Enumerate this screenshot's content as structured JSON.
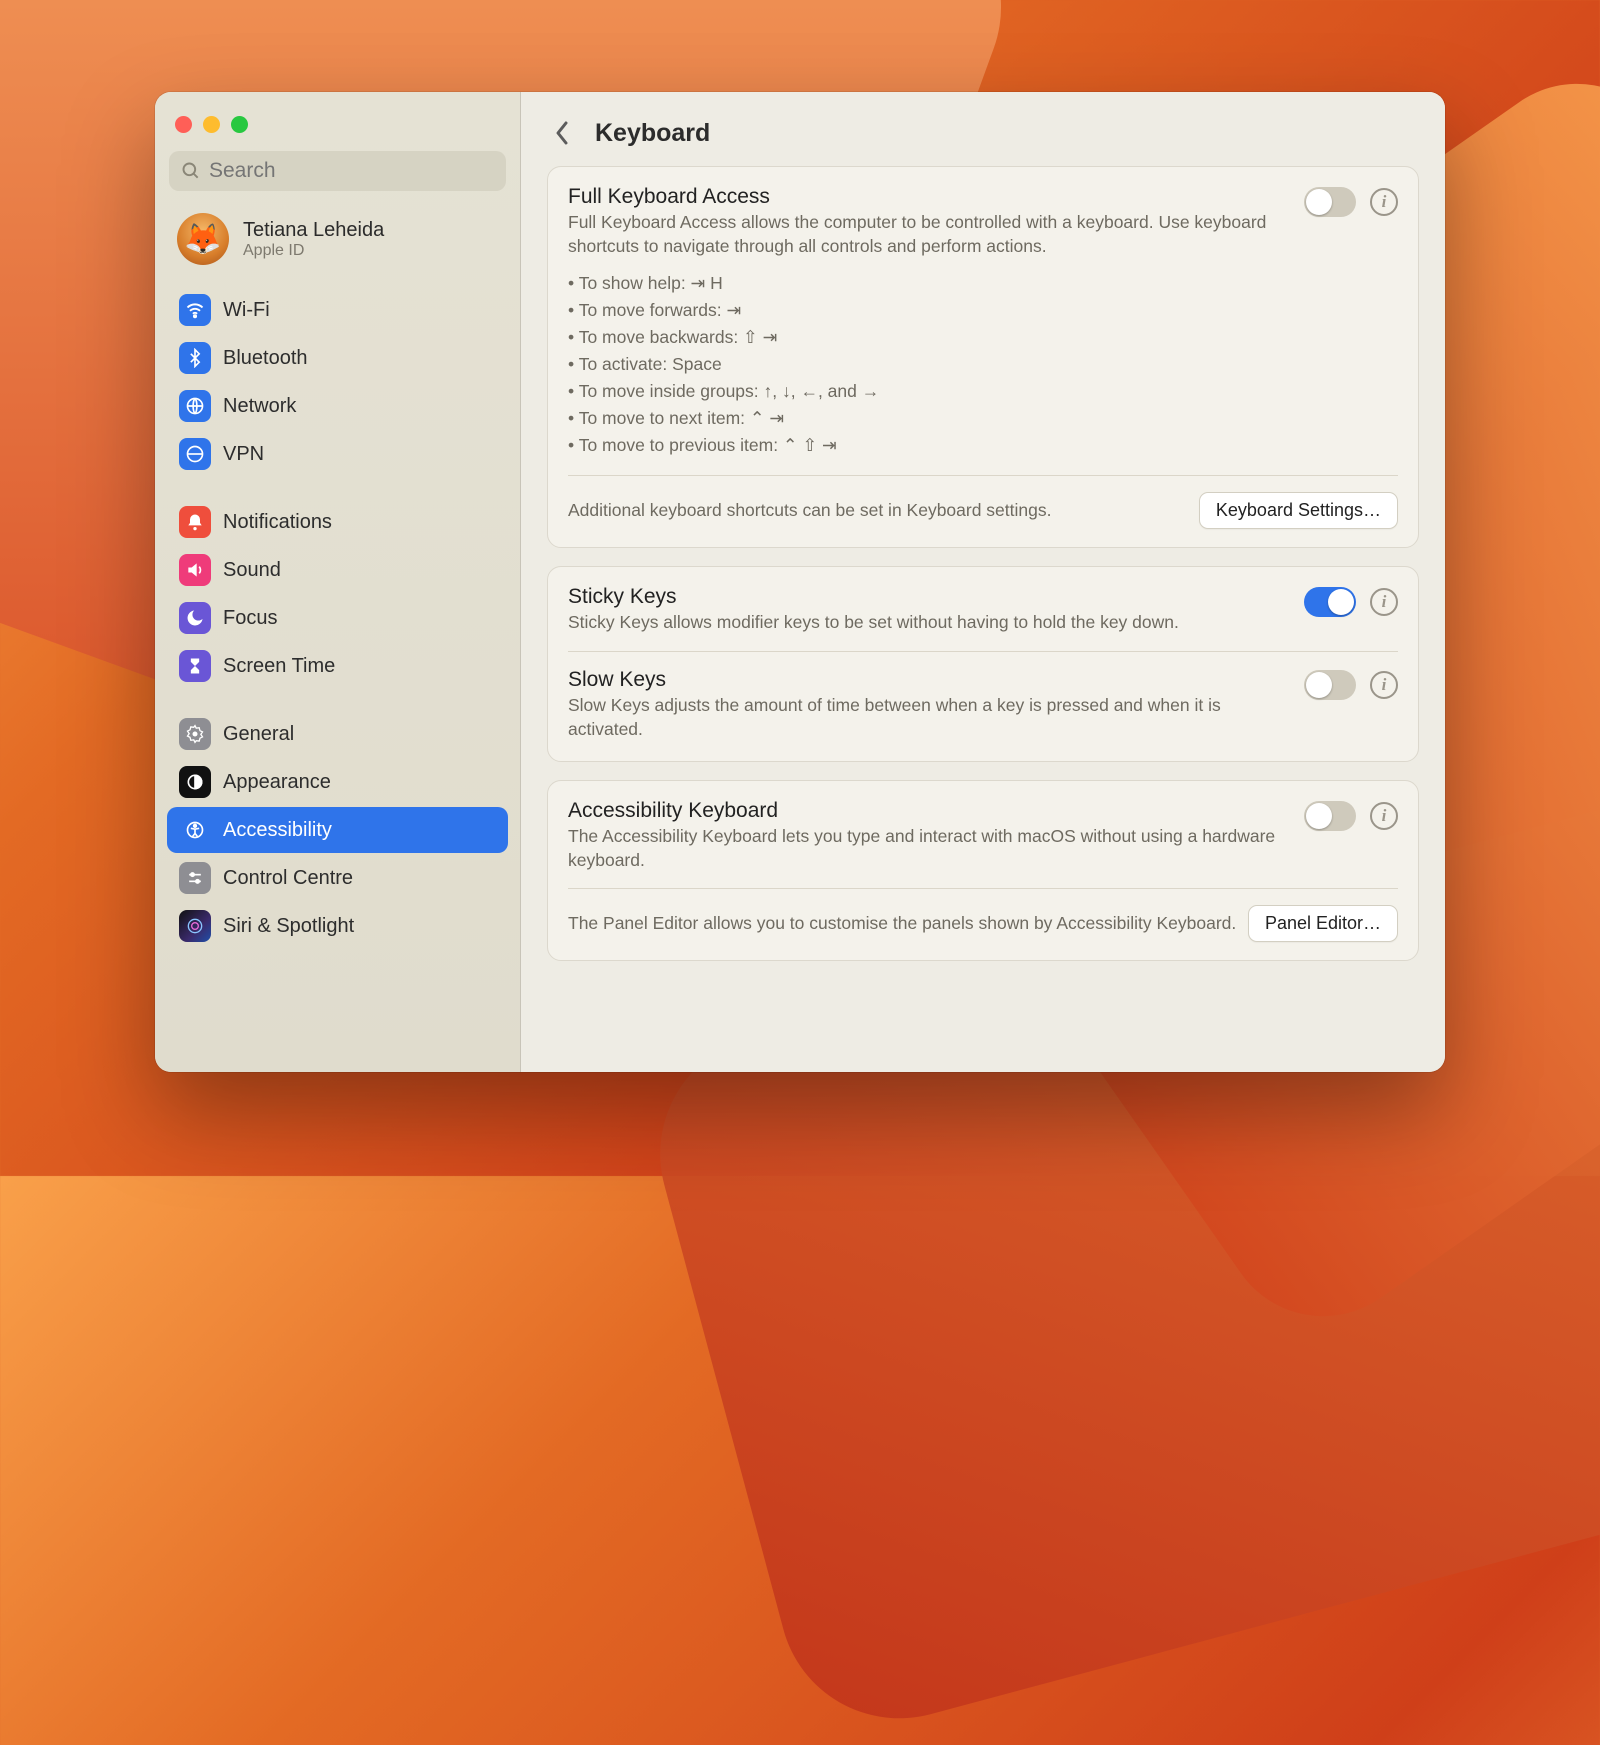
{
  "search": {
    "placeholder": "Search"
  },
  "account": {
    "name": "Tetiana Leheida",
    "sub": "Apple ID"
  },
  "sidebar": {
    "group1": [
      "Wi-Fi",
      "Bluetooth",
      "Network",
      "VPN"
    ],
    "group2": [
      "Notifications",
      "Sound",
      "Focus",
      "Screen Time"
    ],
    "group3": [
      "General",
      "Appearance",
      "Accessibility",
      "Control Centre",
      "Siri & Spotlight"
    ]
  },
  "page": {
    "title": "Keyboard"
  },
  "fka": {
    "title": "Full Keyboard Access",
    "desc": "Full Keyboard Access allows the computer to be controlled with a keyboard. Use keyboard shortcuts to navigate through all controls and perform actions.",
    "shortcuts": [
      "To show help: ⇥ H",
      "To move forwards: ⇥",
      "To move backwards: ⇧ ⇥",
      "To activate: Space",
      "To move inside groups: ↑, ↓, ←, and →",
      "To move to next item: ⌃ ⇥",
      "To move to previous item: ⌃ ⇧ ⇥"
    ],
    "note": "Additional keyboard shortcuts can be set in Keyboard settings.",
    "button": "Keyboard Settings…"
  },
  "sticky": {
    "title": "Sticky Keys",
    "desc": "Sticky Keys allows modifier keys to be set without having to hold the key down."
  },
  "slow": {
    "title": "Slow Keys",
    "desc": "Slow Keys adjusts the amount of time between when a key is pressed and when it is activated."
  },
  "ak": {
    "title": "Accessibility Keyboard",
    "desc": "The Accessibility Keyboard lets you type and interact with macOS without using a hardware keyboard.",
    "note": "The Panel Editor allows you to customise the panels shown by Accessibility Keyboard.",
    "button": "Panel Editor…"
  }
}
